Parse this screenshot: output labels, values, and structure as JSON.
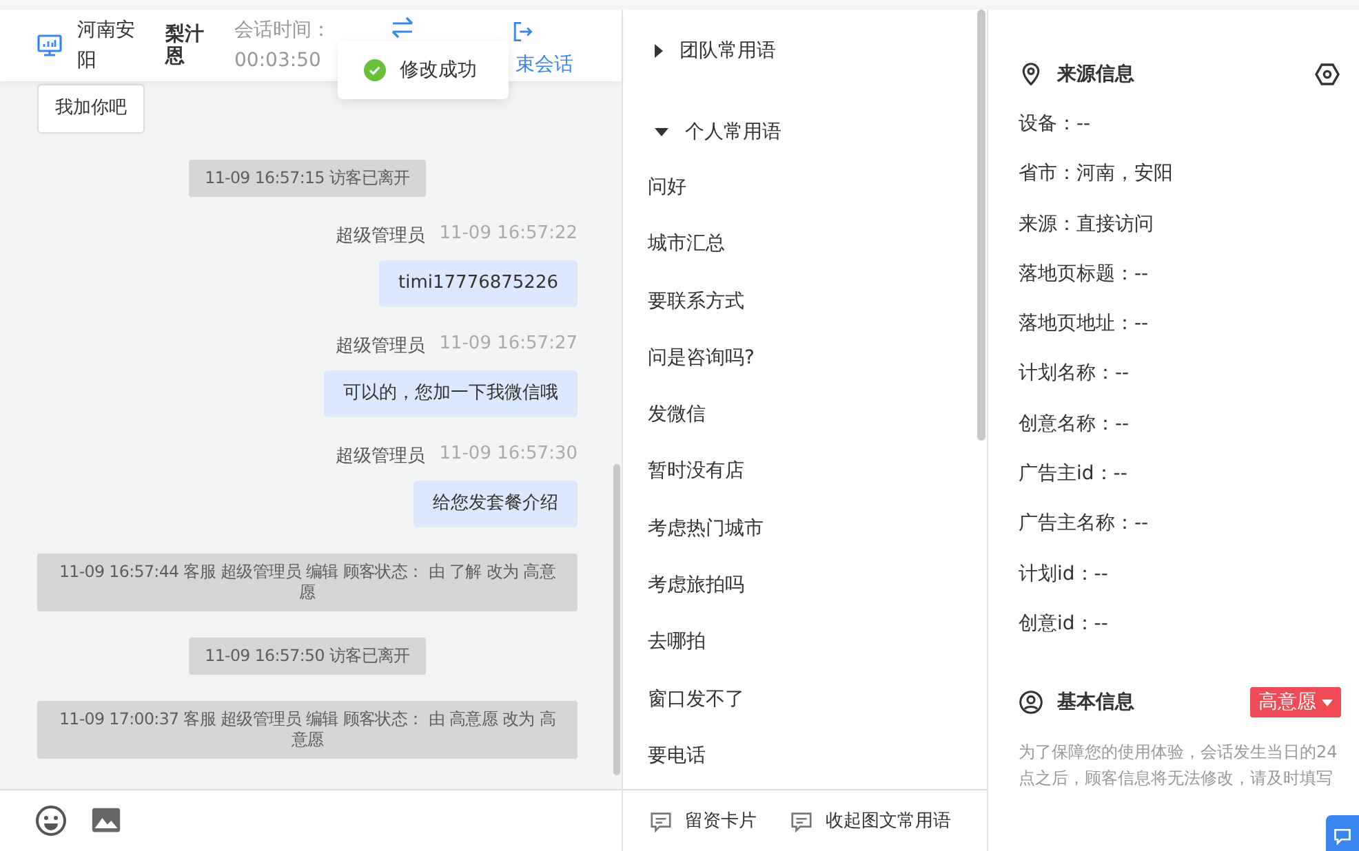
{
  "header": {
    "location": "河南安阳",
    "visitor_name": "梨汁恩",
    "session_time_label": "会话时间：",
    "session_time": "00:03:50",
    "end_session_label": "束会话"
  },
  "toast": {
    "message": "修改成功"
  },
  "messages": [
    {
      "kind": "visitor",
      "text": "我加你吧"
    },
    {
      "kind": "system",
      "text": "11-09 16:57:15 访客已离开"
    },
    {
      "kind": "agent",
      "sender": "超级管理员",
      "time": "11-09 16:57:22",
      "text": "timi17776875226"
    },
    {
      "kind": "agent",
      "sender": "超级管理员",
      "time": "11-09 16:57:27",
      "text": "可以的，您加一下我微信哦"
    },
    {
      "kind": "agent",
      "sender": "超级管理员",
      "time": "11-09 16:57:30",
      "text": "给您发套餐介绍"
    },
    {
      "kind": "system",
      "text": "11-09 16:57:44 客服 超级管理员 编辑 顾客状态： 由 了解 改为 高意愿"
    },
    {
      "kind": "system",
      "text": "11-09 16:57:50 访客已离开"
    },
    {
      "kind": "system",
      "text": "11-09 17:00:37 客服 超级管理员 编辑 顾客状态： 由 高意愿 改为 高意愿"
    }
  ],
  "phrase_groups": [
    {
      "label": "团队常用语",
      "expanded": false
    },
    {
      "label": "个人常用语",
      "expanded": true,
      "items": [
        "问好",
        "城市汇总",
        "要联系方式",
        "问是咨询吗?",
        "发微信",
        "暂时没有店",
        "考虑热门城市",
        "考虑旅拍吗",
        "去哪拍",
        "窗口发不了",
        "要电话"
      ]
    }
  ],
  "bottom_actions": [
    "留资卡片",
    "收起图文常用语"
  ],
  "source_info": {
    "title": "来源信息",
    "fields": [
      "设备：--",
      "省市：河南，安阳",
      "来源：直接访问",
      "落地页标题：--",
      "落地页地址：--",
      "计划名称：--",
      "创意名称：--",
      "广告主id：--",
      "广告主名称：--",
      "计划id：--",
      "创意id：--"
    ]
  },
  "basic_info": {
    "title": "基本信息",
    "status_tag": "高意愿",
    "note": "为了保障您的使用体验，会话发生当日的24点之后，顾客信息将无法修改，请及时填写"
  }
}
